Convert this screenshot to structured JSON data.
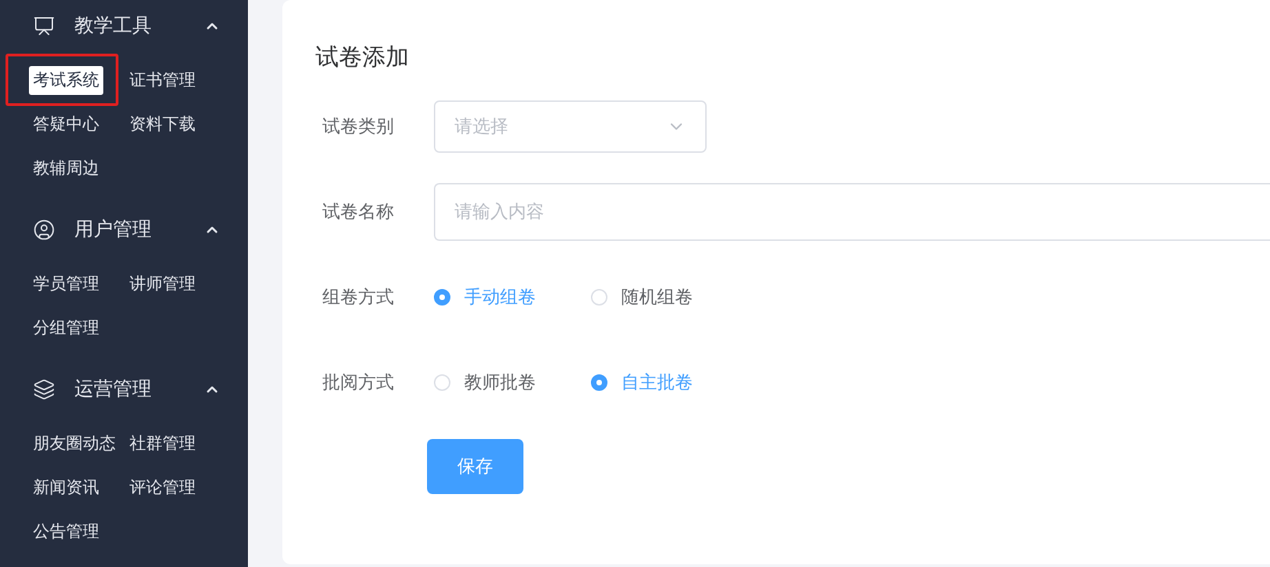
{
  "sidebar": {
    "groups": [
      {
        "kind": "tool",
        "title": "教学工具",
        "expanded": true,
        "items": [
          {
            "label": "考试系统",
            "selected": true,
            "highlighted": true
          },
          {
            "label": "证书管理",
            "selected": false,
            "highlighted": false
          },
          {
            "label": "答疑中心",
            "selected": false,
            "highlighted": false
          },
          {
            "label": "资料下载",
            "selected": false,
            "highlighted": false
          },
          {
            "label": "教辅周边",
            "selected": false,
            "highlighted": false
          }
        ]
      },
      {
        "kind": "user",
        "title": "用户管理",
        "expanded": true,
        "items": [
          {
            "label": "学员管理",
            "selected": false,
            "highlighted": false
          },
          {
            "label": "讲师管理",
            "selected": false,
            "highlighted": false
          },
          {
            "label": "分组管理",
            "selected": false,
            "highlighted": false
          }
        ]
      },
      {
        "kind": "layers",
        "title": "运营管理",
        "expanded": true,
        "items": [
          {
            "label": "朋友圈动态",
            "selected": false,
            "highlighted": false
          },
          {
            "label": "社群管理",
            "selected": false,
            "highlighted": false
          },
          {
            "label": "新闻资讯",
            "selected": false,
            "highlighted": false
          },
          {
            "label": "评论管理",
            "selected": false,
            "highlighted": false
          },
          {
            "label": "公告管理",
            "selected": false,
            "highlighted": false
          }
        ]
      }
    ]
  },
  "form": {
    "title": "试卷添加",
    "fields": [
      {
        "kind": "select",
        "label": "试卷类别",
        "placeholder": "请选择"
      },
      {
        "kind": "input",
        "label": "试卷名称",
        "placeholder": "请输入内容"
      },
      {
        "kind": "radio",
        "label": "组卷方式",
        "options": [
          {
            "label": "手动组卷",
            "selected": true
          },
          {
            "label": "随机组卷",
            "selected": false
          }
        ]
      },
      {
        "kind": "radio",
        "label": "批阅方式",
        "options": [
          {
            "label": "教师批卷",
            "selected": false
          },
          {
            "label": "自主批卷",
            "selected": true
          }
        ]
      }
    ],
    "submit": "保存"
  }
}
